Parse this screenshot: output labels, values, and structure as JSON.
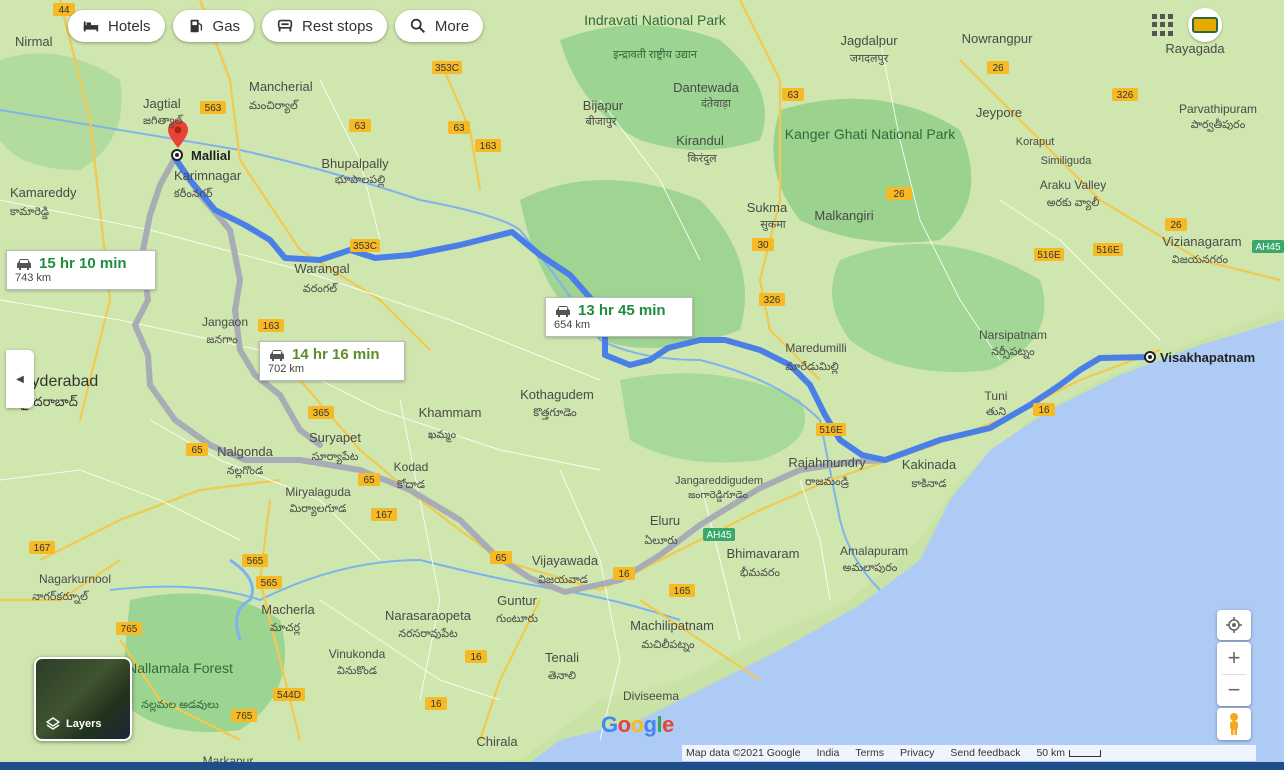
{
  "chips": [
    {
      "label": "Hotels",
      "icon": "bed-icon"
    },
    {
      "label": "Gas",
      "icon": "gas-pump-icon"
    },
    {
      "label": "Rest stops",
      "icon": "rest-stop-icon"
    },
    {
      "label": "More",
      "icon": "search-icon"
    }
  ],
  "routes": [
    {
      "time": "15 hr 10 min",
      "distance": "743 km"
    },
    {
      "time": "13 hr 45 min",
      "distance": "654 km"
    },
    {
      "time": "14 hr 16 min",
      "distance": "702 km"
    }
  ],
  "origin": "Mallial",
  "destination": "Visakhapatnam",
  "places": {
    "indravati": "Indravati National Park",
    "indravati_local": "इन्द्रावती राष्ट्रीय उद्यान",
    "jagdalpur": "Jagdalpur",
    "jagdalpur_local": "जगदलपुर",
    "nowrangpur": "Nowrangpur",
    "rayagada": "Rayagada",
    "nirmal": "Nirmal",
    "mancherial": "Mancherial",
    "mancherial_local": "మంచిర్యాల్",
    "jagtial": "Jagtial",
    "jagtial_local": "జగిత్యాల్",
    "dantewada": "Dantewada",
    "dantewada_local": "दंतेवाड़ा",
    "bijapur": "Bijapur",
    "bijapur_local": "बीजापुर",
    "kirandul": "Kirandul",
    "kirandul_local": "किरंदुल",
    "kanger": "Kanger Ghati National Park",
    "jeypore": "Jeypore",
    "koraput": "Koraput",
    "similiguda": "Similiguda",
    "parvathipuram": "Parvathipuram",
    "parvathipuram_local": "పార్వతీపురం",
    "karimnagar": "Karimnagar",
    "karimnagar_local": "కరీంనగర్",
    "bhupalpally": "Bhupalpally",
    "bhupalpally_local": "భూపాలపల్లి",
    "kamareddy": "Kamareddy",
    "kamareddy_local": "కామారెడ్డి",
    "sukma": "Sukma",
    "sukma_local": "सुकमा",
    "malkangiri": "Malkangiri",
    "araku": "Araku Valley",
    "araku_local": "అరకు వ్యాలీ",
    "vizianagaram": "Vizianagaram",
    "vizianagaram_local": "విజయనగరం",
    "warangal": "Warangal",
    "warangal_local": "వరంగల్",
    "jangaon": "Jangaon",
    "jangaon_local": "జనగాం",
    "narsipatnam": "Narsipatnam",
    "narsipatnam_local": "నర్సీపట్నం",
    "maredumilli": "Maredumilli",
    "maredumilli_local": "మారేడుమిల్లి",
    "hyderabad": "Hyderabad",
    "hyderabad_local": "హైదరాబాద్",
    "kothagudem": "Kothagudem",
    "kothagudem_local": "కొత్తగూడెం",
    "khammam": "Khammam",
    "khammam_local": "ఖమ్మం",
    "tuni": "Tuni",
    "tuni_local": "తుని",
    "suryapet": "Suryapet",
    "suryapet_local": "సూర్యాపేట",
    "nalgonda": "Nalgonda",
    "nalgonda_local": "నల్లగొండ",
    "kodad": "Kodad",
    "kodad_local": "కోదాడ",
    "rajahmundry": "Rajahmundry",
    "rajahmundry_local": "రాజమండ్రి",
    "kakinada": "Kakinada",
    "kakinada_local": "కాకినాడ",
    "jangareddigudem": "Jangareddigudem",
    "jangareddigudem_local": "జంగారెడ్డిగూడెం",
    "miryalaguda": "Miryalaguda",
    "miryalaguda_local": "మిర్యాలగూడ",
    "eluru": "Eluru",
    "eluru_local": "ఏలూరు",
    "bhimavaram": "Bhimavaram",
    "bhimavaram_local": "భీమవరం",
    "amalapuram": "Amalapuram",
    "amalapuram_local": "అమలాపురం",
    "vijayawada": "Vijayawada",
    "vijayawada_local": "విజయవాడ",
    "nagarkurnool": "Nagarkurnool",
    "nagarkurnool_local": "నాగర్‌కర్నూల్",
    "macherla": "Macherla",
    "macherla_local": "మాచర్ల",
    "narasaraopeta": "Narasaraopeta",
    "narasaraopeta_local": "నరసరావుపేట",
    "guntur": "Guntur",
    "guntur_local": "గుంటూరు",
    "machilipatnam": "Machilipatnam",
    "machilipatnam_local": "మచిలీపట్నం",
    "vinukonda": "Vinukonda",
    "vinukonda_local": "వినుకొండ",
    "tenali": "Tenali",
    "tenali_local": "తెనాలి",
    "nallamala": "Nallamala Forest",
    "nallamala_local": "నల్లమల అడవులు",
    "diviseema": "Diviseema",
    "diviseema_local": "దివిసీమ",
    "chirala": "Chirala",
    "markapur": "Markapur"
  },
  "roads": [
    "44",
    "353C",
    "63",
    "563",
    "63",
    "163",
    "353C",
    "63",
    "26",
    "326",
    "26",
    "30",
    "326",
    "516E",
    "26",
    "516E",
    "163",
    "516E",
    "365",
    "16",
    "65",
    "65",
    "167",
    "167",
    "565",
    "65",
    "16",
    "AH45",
    "565",
    "765",
    "165",
    "16",
    "544D",
    "765",
    "16",
    "AH45"
  ],
  "layers_label": "Layers",
  "footer": {
    "map_data": "Map data ©2021 Google",
    "india": "India",
    "terms": "Terms",
    "privacy": "Privacy",
    "feedback": "Send feedback",
    "scale": "50 km"
  },
  "colors": {
    "route_primary": "#4a7fe8",
    "route_alt": "#a8adb5",
    "water": "#aecbf5",
    "land": "#c9e2a6",
    "time_text": "#1e8e3e",
    "pin": "#ea4335"
  }
}
